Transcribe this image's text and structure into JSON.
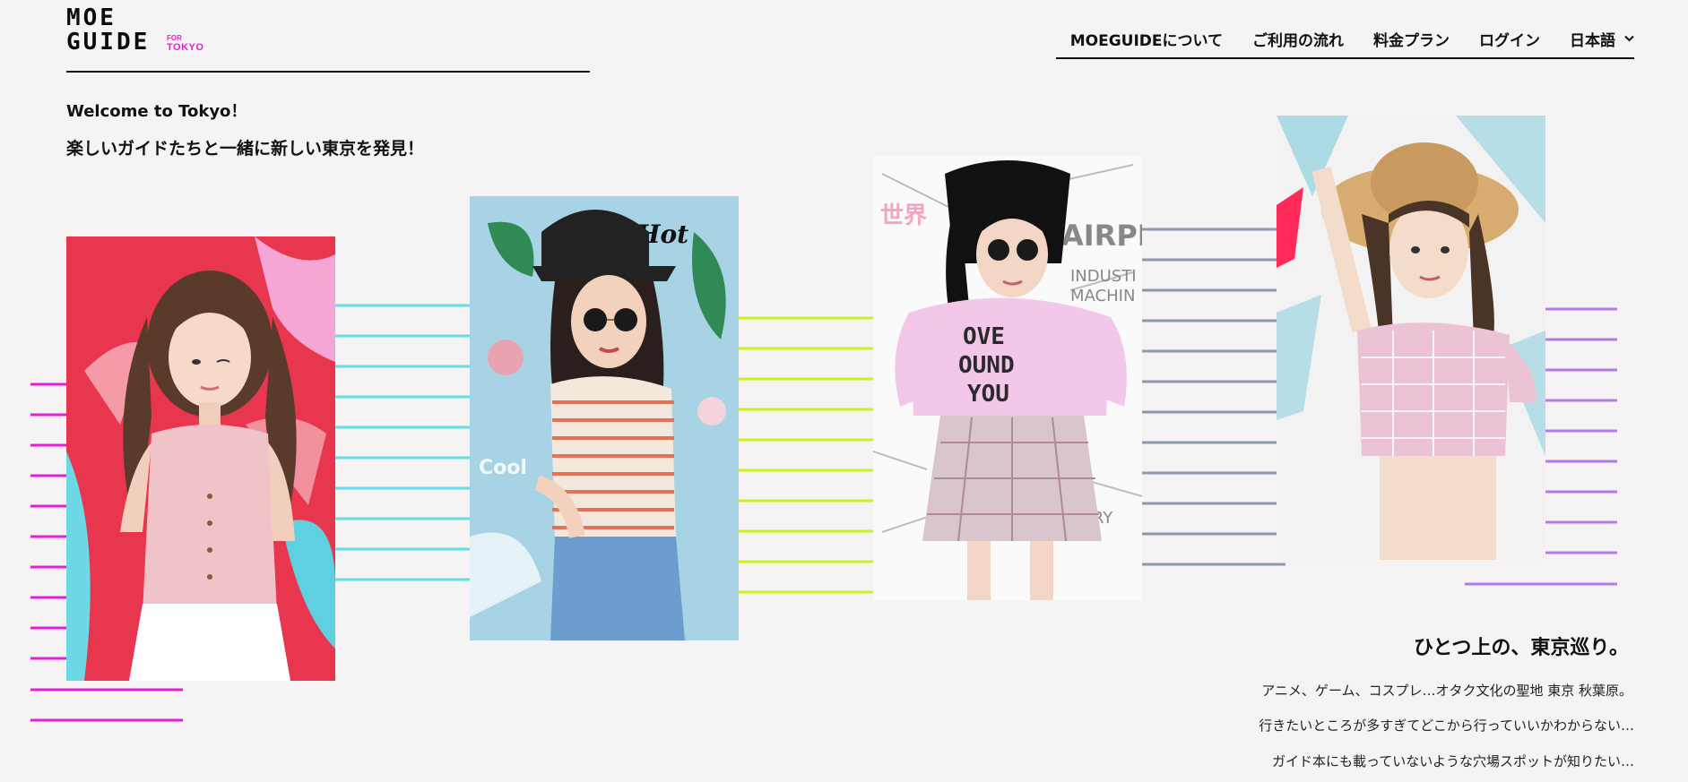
{
  "logo": {
    "line1": "MOE",
    "line2": "GUIDE",
    "for": "FOR",
    "city": "TOKYO"
  },
  "nav": {
    "items": [
      "MOEGUIDEについて",
      "ご利用の流れ",
      "料金プラン",
      "ログイン"
    ],
    "language": "日本語",
    "language_icon": "chevron-down-icon"
  },
  "hero": {
    "welcome": "Welcome to Tokyo！",
    "tagline": "楽しいガイドたちと一緒に新しい東京を発見！"
  },
  "gallery": {
    "photos": [
      {
        "label": "guide-photo-1",
        "accent": "#e51fd6",
        "bg": "#e8364f",
        "top_text": "",
        "shirt_text": ""
      },
      {
        "label": "guide-photo-2",
        "accent": "#5fe0e6",
        "bg": "#a7d3e4",
        "top_text": "Hot",
        "shirt_text": ""
      },
      {
        "label": "guide-photo-3",
        "accent": "#c6f51a",
        "bg": "#ffffff",
        "top_text": "AIRPL",
        "shirt_text": "OVE\nOUND\nYOU"
      },
      {
        "label": "guide-photo-4",
        "accent": "#8e99b0",
        "bg": "#f2f2f2",
        "top_text": "",
        "shirt_text": ""
      }
    ],
    "stripe_colors": [
      "#e51fd6",
      "#5fe0e6",
      "#c6f51a",
      "#8e99b0",
      "#b47ae8"
    ]
  },
  "intro": {
    "title": "ひとつ上の、東京巡り。",
    "lines": [
      "アニメ、ゲーム、コスプレ…オタク文化の聖地 東京 秋葉原。",
      "行きたいところが多すぎてどこから行っていいかわからない…",
      "ガイド本にも載っていないような穴場スポットが知りたい…"
    ]
  }
}
